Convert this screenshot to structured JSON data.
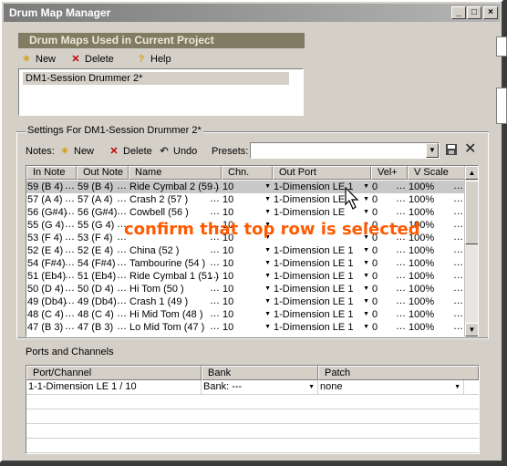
{
  "window": {
    "title": "Drum Map Manager"
  },
  "title_buttons": {
    "minimize": "_",
    "maximize": "□",
    "close": "×"
  },
  "maps_section": {
    "header": "Drum Maps Used in Current Project",
    "new_label": "New",
    "delete_label": "Delete",
    "help_label": "Help",
    "maps": [
      "DM1-Session Drummer 2*"
    ]
  },
  "settings": {
    "group_label": "Settings For DM1-Session Drummer 2*",
    "notes_label": "Notes:",
    "new_label": "New",
    "delete_label": "Delete",
    "undo_label": "Undo",
    "presets_label": "Presets:",
    "presets_value": ""
  },
  "grid": {
    "columns": [
      "In Note",
      "Out Note",
      "Name",
      "Chn.",
      "Out Port",
      "Vel+",
      "V Scale"
    ],
    "rows": [
      {
        "in": "59 (B 4)",
        "out": "59 (B 4)",
        "name": "Ride Cymbal 2 (59 )",
        "chn": "10",
        "port": "1-Dimension LE 1",
        "vel": "0",
        "vscale": "100%",
        "selected": true
      },
      {
        "in": "57 (A 4)",
        "out": "57 (A 4)",
        "name": "Crash 2 (57 )",
        "chn": "10",
        "port": "1-Dimension LE",
        "vel": "0",
        "vscale": "100%"
      },
      {
        "in": "56 (G#4)",
        "out": "56 (G#4)",
        "name": "Cowbell (56 )",
        "chn": "10",
        "port": "1-Dimension LE",
        "vel": "0",
        "vscale": "100%"
      },
      {
        "in": "55 (G 4)",
        "out": "55 (G 4)",
        "name": "",
        "chn": "10",
        "port": "",
        "vel": "0",
        "vscale": "100%"
      },
      {
        "in": "53 (F 4)",
        "out": "53 (F 4)",
        "name": "",
        "chn": "10",
        "port": "",
        "vel": "0",
        "vscale": "100%"
      },
      {
        "in": "52 (E 4)",
        "out": "52 (E 4)",
        "name": "China (52 )",
        "chn": "10",
        "port": "1-Dimension LE 1",
        "vel": "0",
        "vscale": "100%"
      },
      {
        "in": "54 (F#4)",
        "out": "54 (F#4)",
        "name": "Tambourine (54 )",
        "chn": "10",
        "port": "1-Dimension LE 1",
        "vel": "0",
        "vscale": "100%"
      },
      {
        "in": "51 (Eb4)",
        "out": "51 (Eb4)",
        "name": "Ride Cymbal 1 (51 )",
        "chn": "10",
        "port": "1-Dimension LE 1",
        "vel": "0",
        "vscale": "100%"
      },
      {
        "in": "50 (D 4)",
        "out": "50 (D 4)",
        "name": "Hi Tom (50 )",
        "chn": "10",
        "port": "1-Dimension LE 1",
        "vel": "0",
        "vscale": "100%"
      },
      {
        "in": "49 (Db4)",
        "out": "49 (Db4)",
        "name": "Crash 1 (49 )",
        "chn": "10",
        "port": "1-Dimension LE 1",
        "vel": "0",
        "vscale": "100%"
      },
      {
        "in": "48 (C 4)",
        "out": "48 (C 4)",
        "name": "Hi Mid Tom (48 )",
        "chn": "10",
        "port": "1-Dimension LE 1",
        "vel": "0",
        "vscale": "100%"
      },
      {
        "in": "47 (B 3)",
        "out": "47 (B 3)",
        "name": "Lo Mid Tom (47 )",
        "chn": "10",
        "port": "1-Dimension LE 1",
        "vel": "0",
        "vscale": "100%"
      }
    ]
  },
  "annotation": {
    "text": "confirm that top row is selected",
    "color": "#ff5a00"
  },
  "ports": {
    "label": "Ports and Channels",
    "columns": [
      "Port/Channel",
      "Bank",
      "Patch"
    ],
    "rows": [
      {
        "port": "1-1-Dimension LE 1 / 10",
        "bank": "Bank: ---",
        "patch": "none"
      }
    ]
  }
}
